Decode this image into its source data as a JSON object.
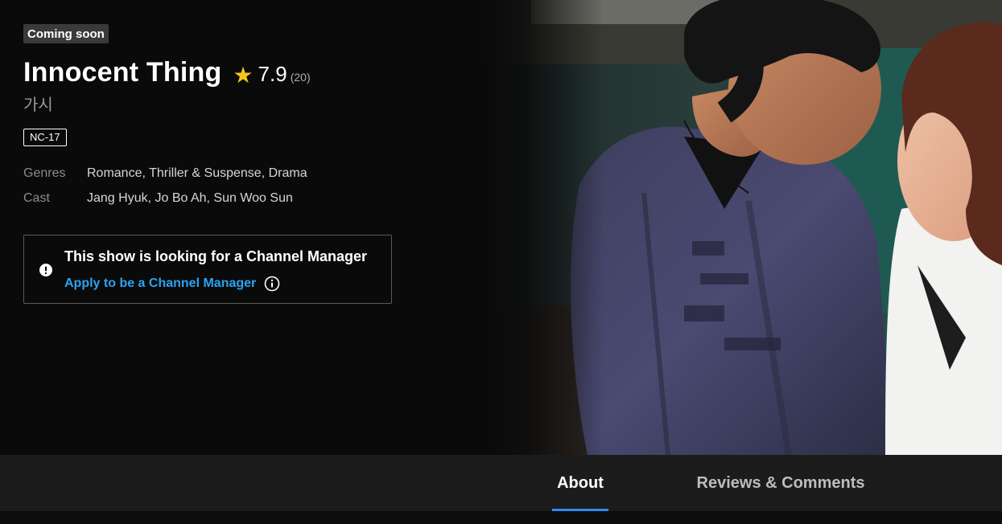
{
  "show": {
    "status_badge": "Coming soon",
    "title": "Innocent Thing",
    "rating_score": "7.9",
    "rating_votes": "(20)",
    "native_title": "가시",
    "certification": "NC-17"
  },
  "details": {
    "genres_label": "Genres",
    "genres_value": "Romance, Thriller & Suspense, Drama",
    "cast_label": "Cast",
    "cast_value": "Jang Hyuk, Jo Bo Ah, Sun Woo Sun"
  },
  "channel_manager": {
    "message": "This show is looking for a Channel Manager",
    "apply_link": "Apply to be a Channel Manager"
  },
  "tabs": [
    {
      "label": "About",
      "active": true
    },
    {
      "label": "Reviews & Comments",
      "active": false
    }
  ],
  "colors": {
    "accent_link": "#2aa4f4",
    "star": "#f5c518",
    "tab_underline": "#2a8ef0"
  },
  "icons": {
    "rating": "star-icon",
    "alert": "exclamation-circle-icon",
    "info": "info-circle-icon"
  }
}
